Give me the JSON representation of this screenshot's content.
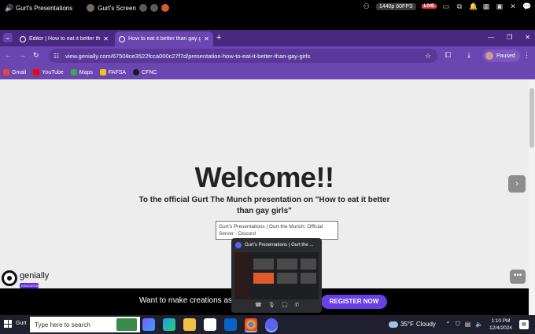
{
  "discord_overlay": {
    "channel": "Gurt's Presentations",
    "screen": "Gurt's Screen",
    "quality": "1440p 60FPS",
    "live": "LIVE"
  },
  "browser": {
    "tabs": [
      {
        "label": "Editor | How to eat it better than gay girls",
        "active": false
      },
      {
        "label": "How to eat it better than gay girls",
        "active": true
      }
    ],
    "url": "view.genially.com/67508ce3522fcca000c27f7d/presentation-how-to-eat-it-better-than-gay-girls",
    "profile_label": "Paused",
    "bookmarks": [
      {
        "label": "Gmail",
        "icon": "gmail-icon",
        "color": "#ea4335"
      },
      {
        "label": "YouTube",
        "icon": "youtube-icon",
        "color": "#ff0000"
      },
      {
        "label": "Maps",
        "icon": "maps-icon",
        "color": "#34a853"
      },
      {
        "label": "FAFSA",
        "icon": "fafsa-icon",
        "color": "#f5c518"
      },
      {
        "label": "CFNC",
        "icon": "cfnc-icon",
        "color": "#1a1a1a"
      }
    ]
  },
  "page": {
    "title": "Welcome!!",
    "subtitle": "To the official Gurt The Munch presentation on \"How to eat it better than gay girls\"",
    "tooltip": "Gurt's Presentations | Gurt the Munch: Official Server - Discord",
    "logo_text": "genially",
    "logo_badge": "EDUCATION",
    "promo_text": "Want to make creations as",
    "register_label": "REGISTER NOW"
  },
  "popup": {
    "title": "Gurt's Presentations | Gurt the ..."
  },
  "taskbar": {
    "user_label": "Gurt",
    "search_placeholder": "Type here to search",
    "temperature": "35°F",
    "condition": "Cloudy",
    "time": "1:10 PM",
    "date": "12/4/2024"
  },
  "colors": {
    "browser_accent": "#6b46b0",
    "register_button": "#6a3fe6",
    "live_badge": "#ed4245"
  }
}
